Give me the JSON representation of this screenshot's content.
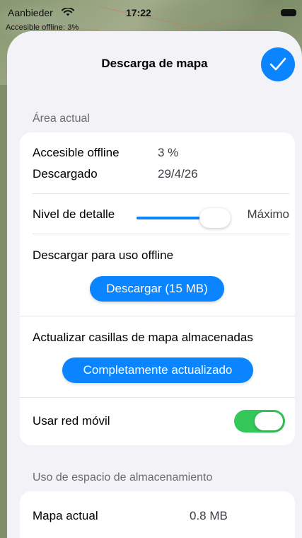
{
  "status_bar": {
    "carrier": "Aanbieder",
    "time": "17:22",
    "wifi_icon": "wifi-icon",
    "battery_icon": "battery-icon"
  },
  "map_overlay": {
    "offline_text": "Accesible offline: 3%"
  },
  "sheet": {
    "title": "Descarga de mapa",
    "done_icon": "checkmark-icon",
    "accent_color": "#0a84ff",
    "toggle_color": "#34c759"
  },
  "current_area": {
    "header": "Área actual",
    "offline_label": "Accesible offline",
    "offline_value": "3 %",
    "downloaded_label": "Descargado",
    "downloaded_value": "29/4/26",
    "detail_label": "Nivel de detalle",
    "detail_value": "Máximo",
    "detail_level": 0.85,
    "download_label": "Descargar para uso offline",
    "download_button": "Descargar (15 MB)",
    "update_label": "Actualizar casillas de mapa almacenadas",
    "update_button": "Completamente actualizado",
    "mobile_label": "Usar red móvil",
    "mobile_enabled": true
  },
  "storage": {
    "header": "Uso de espacio de almacenamiento",
    "current_map_label": "Mapa actual",
    "current_map_value": "0.8 MB"
  }
}
